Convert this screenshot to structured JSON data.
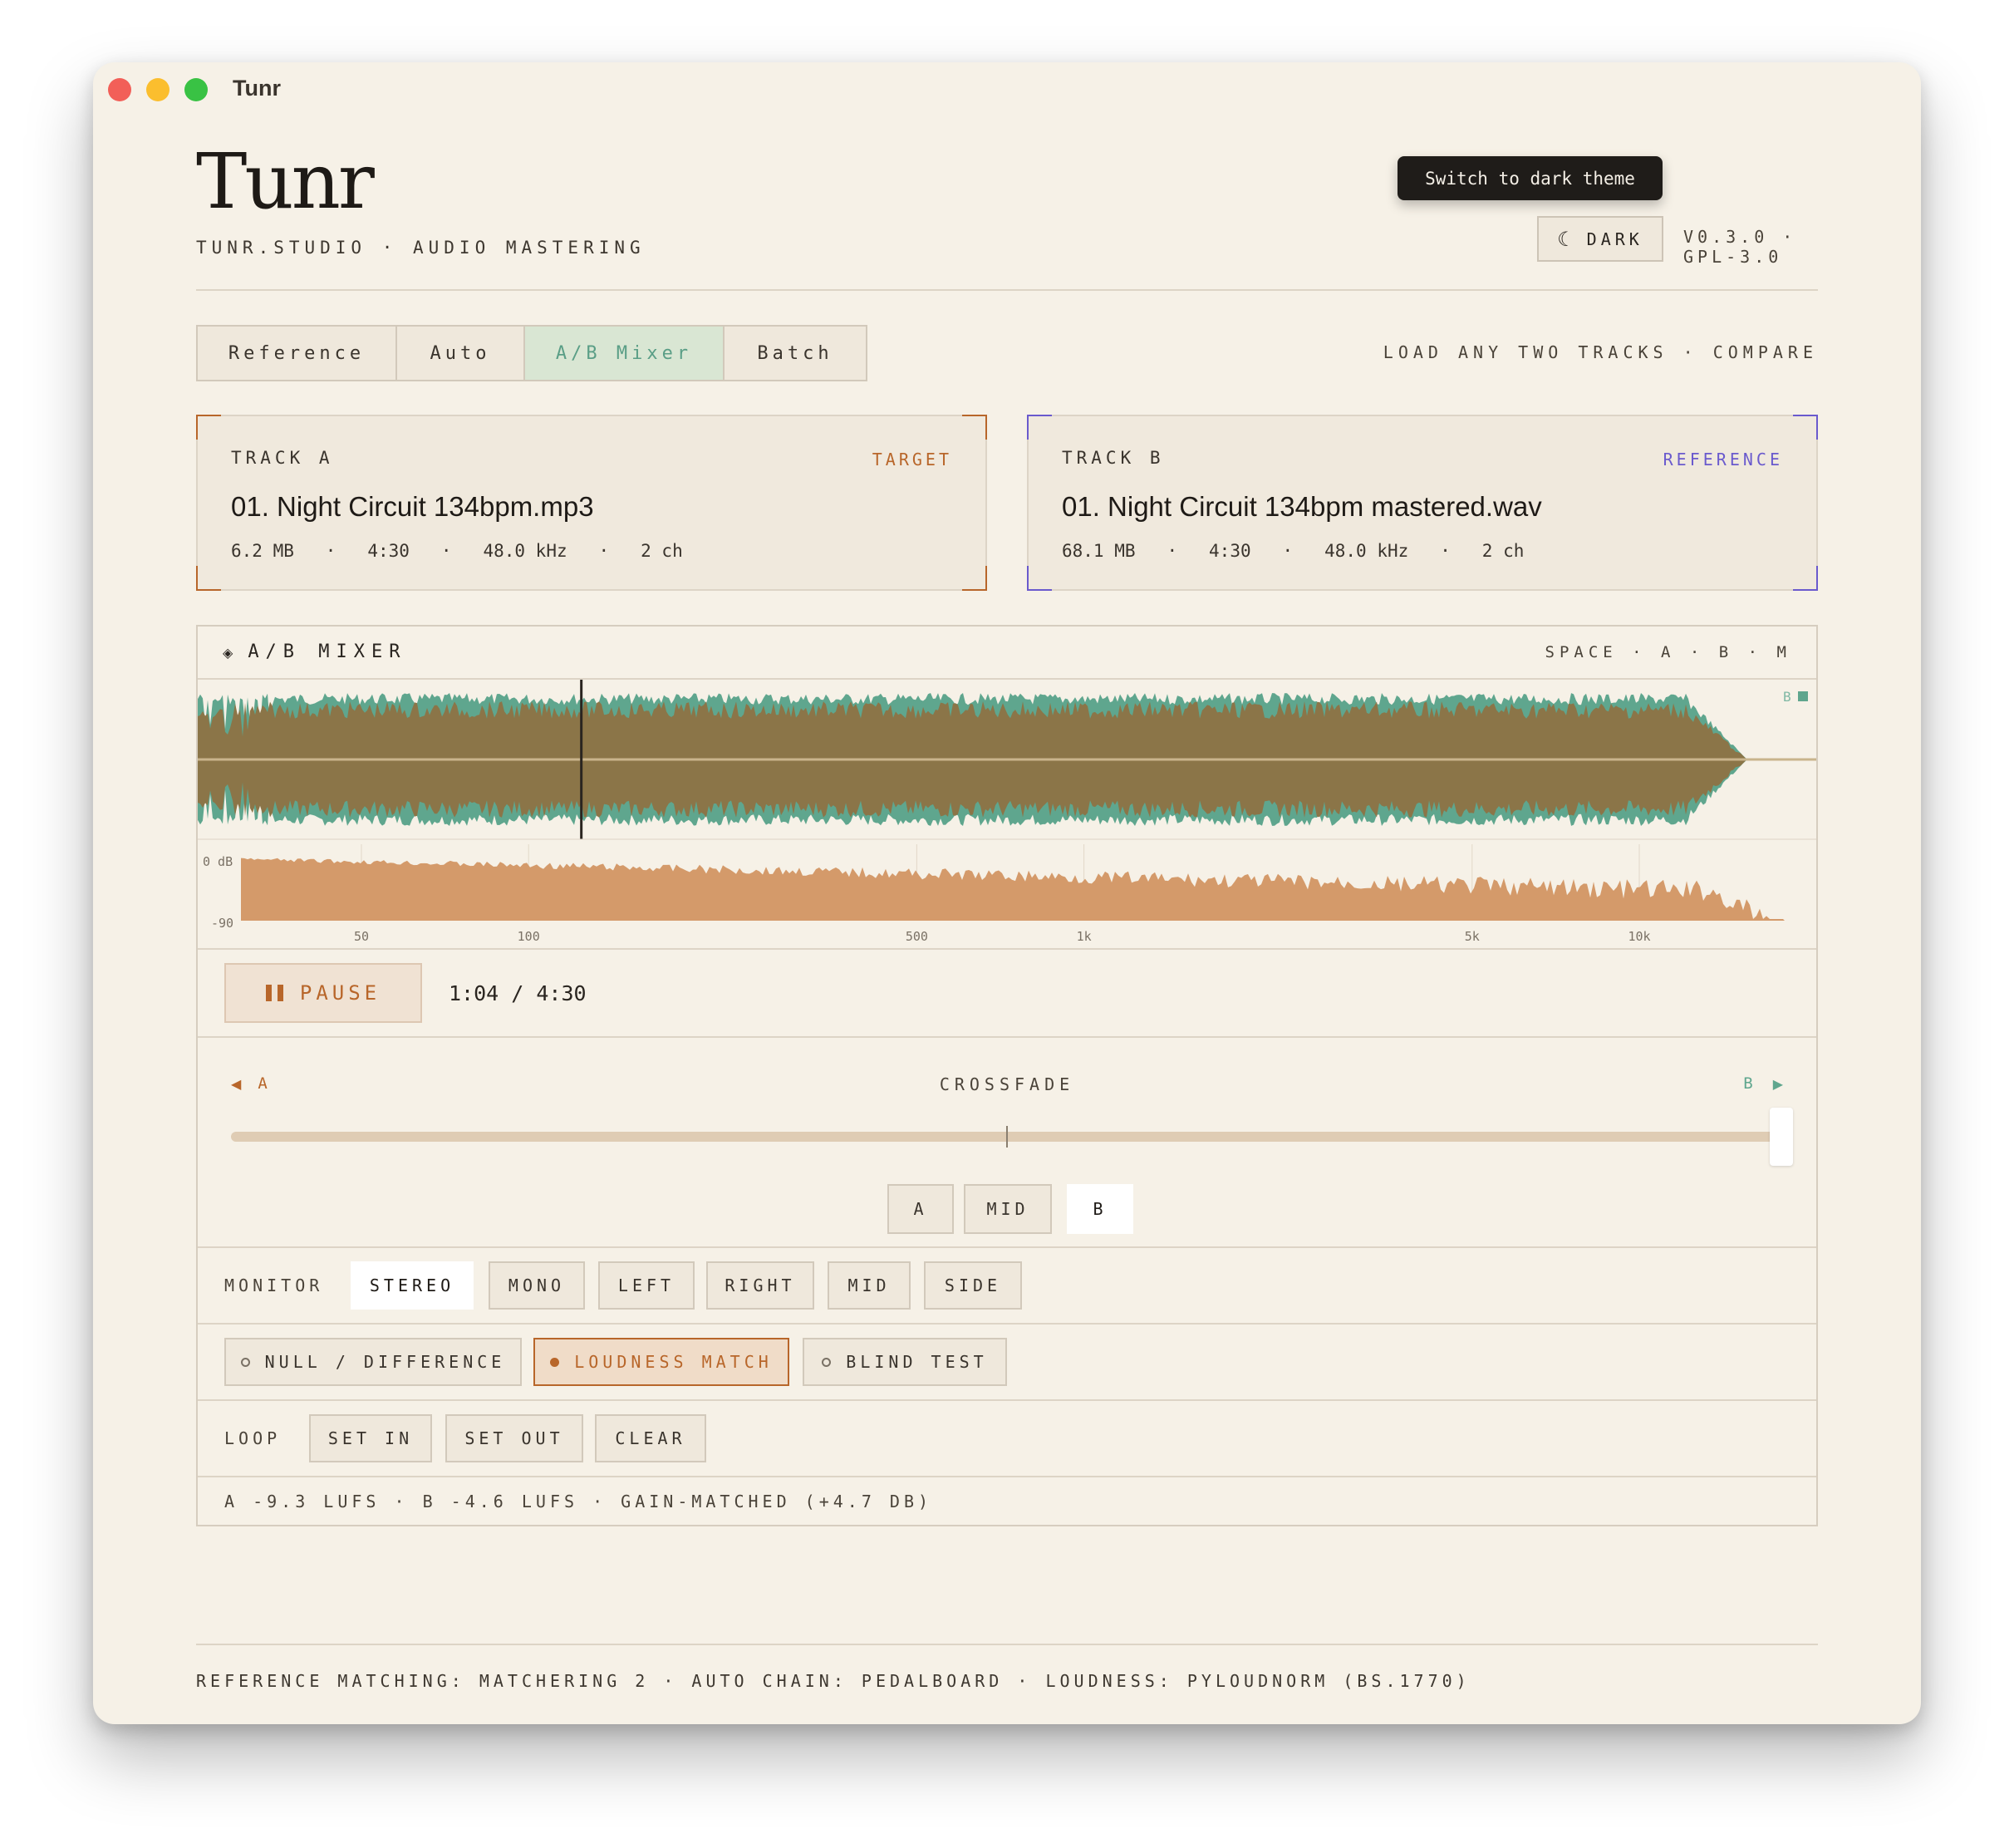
{
  "window": {
    "title": "Tunr"
  },
  "header": {
    "brand": "Tunr",
    "subtitle": "TUNR.STUDIO · AUDIO MASTERING",
    "tooltip": "Switch to dark theme",
    "theme_icon": "moon-icon",
    "theme_label": "DARK",
    "version": "V0.3.0 · GPL-3.0"
  },
  "tabs": [
    {
      "label": "Reference",
      "active": false
    },
    {
      "label": "Auto",
      "active": false
    },
    {
      "label": "A/B Mixer",
      "active": true
    },
    {
      "label": "Batch",
      "active": false
    }
  ],
  "tab_hint": "LOAD ANY TWO TRACKS · COMPARE",
  "tracks": {
    "a": {
      "label": "TRACK A",
      "role": "TARGET",
      "name": "01. Night Circuit 134bpm.mp3",
      "size": "6.2 MB",
      "duration": "4:30",
      "rate": "48.0 kHz",
      "channels": "2 ch"
    },
    "b": {
      "label": "TRACK B",
      "role": "REFERENCE",
      "name": "01. Night Circuit 134bpm mastered.wav",
      "size": "68.1 MB",
      "duration": "4:30",
      "rate": "48.0 kHz",
      "channels": "2 ch"
    }
  },
  "colors": {
    "accent_a": "#b8662a",
    "accent_b": "#6a5acd",
    "wave_a": "#8b7548",
    "wave_b": "#5fa68e",
    "spectrum": "#d49a6a",
    "active_tab": "#d9e6d3"
  },
  "mixer": {
    "title": "A/B MIXER",
    "icon": "diamond-icon",
    "shortcuts": "SPACE · A · B · M",
    "waveform_marker": "B",
    "playhead_fraction": 0.237,
    "spectrum": {
      "top_label": "0 dB",
      "bottom_label": "-90",
      "freq_labels": [
        "50",
        "100",
        "500",
        "1k",
        "5k",
        "10k"
      ]
    },
    "pause_label": "PAUSE",
    "time": "1:04 / 4:30",
    "crossfade": {
      "title": "CROSSFADE",
      "left_label": "A",
      "right_label": "B",
      "value": 1.0,
      "buttons": [
        "A",
        "MID",
        "B"
      ],
      "selected": "B"
    },
    "monitor": {
      "label": "MONITOR",
      "options": [
        "STEREO",
        "MONO",
        "LEFT",
        "RIGHT",
        "MID",
        "SIDE"
      ],
      "selected": "STEREO"
    },
    "modes": [
      {
        "label": "NULL / DIFFERENCE",
        "active": false
      },
      {
        "label": "LOUDNESS MATCH",
        "active": true
      },
      {
        "label": "BLIND TEST",
        "active": false
      }
    ],
    "loop": {
      "label": "LOOP",
      "set_in": "SET IN",
      "set_out": "SET OUT",
      "clear": "CLEAR"
    },
    "loudness": "A -9.3 LUFS · B -4.6 LUFS · GAIN-MATCHED (+4.7 DB)"
  },
  "footer": "REFERENCE MATCHING: MATCHERING 2 · AUTO CHAIN: PEDALBOARD · LOUDNESS: PYLOUDNORM (BS.1770)"
}
